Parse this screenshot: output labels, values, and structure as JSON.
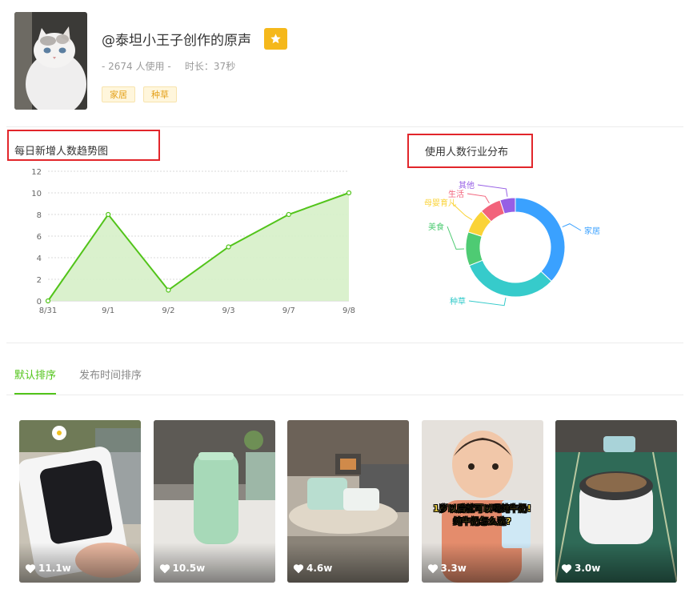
{
  "header": {
    "title": "@泰坦小王子创作的原声",
    "usage": "- 2674 人使用 -",
    "duration": "时长：37秒",
    "tags": [
      "家居",
      "种草"
    ]
  },
  "sections": {
    "trend_title": "每日新增人数趋势图",
    "industry_title": "使用人数行业分布"
  },
  "tabs": [
    {
      "label": "默认排序",
      "active": true
    },
    {
      "label": "发布时间排序",
      "active": false
    }
  ],
  "videos": [
    {
      "likes": "11.1w"
    },
    {
      "likes": "10.5w"
    },
    {
      "likes": "4.6w"
    },
    {
      "likes": "3.3w",
      "caption_line1": "1岁以后就可以喝纯牛奶!",
      "caption_line2": "纯牛奶怎么选?"
    },
    {
      "likes": "3.0w"
    }
  ],
  "colors": {
    "accent_green": "#52c41a",
    "tag_orange": "#e4a11b",
    "highlight_red": "#e2262b",
    "star_badge": "#f5b81b"
  },
  "chart_data": [
    {
      "type": "area",
      "title": "每日新增人数趋势图",
      "x": [
        "8/31",
        "9/1",
        "9/2",
        "9/3",
        "9/7",
        "9/8"
      ],
      "series": [
        {
          "values": [
            0,
            8,
            1,
            5,
            8,
            10
          ]
        }
      ],
      "ylim": [
        0,
        12
      ],
      "yticks": [
        "0",
        "2",
        "4",
        "6",
        "8",
        "10",
        "12"
      ],
      "grid": true,
      "color": "#52c41a"
    },
    {
      "type": "pie",
      "title": "使用人数行业分布",
      "donut": true,
      "labels": [
        "家居",
        "种草",
        "美食",
        "母婴育儿",
        "生活",
        "其他"
      ],
      "values": [
        37,
        32,
        11,
        8,
        7,
        5
      ],
      "colors": [
        "#3aa1ff",
        "#36cbcb",
        "#4ecb73",
        "#fad337",
        "#f2637b",
        "#975fe5"
      ]
    }
  ]
}
